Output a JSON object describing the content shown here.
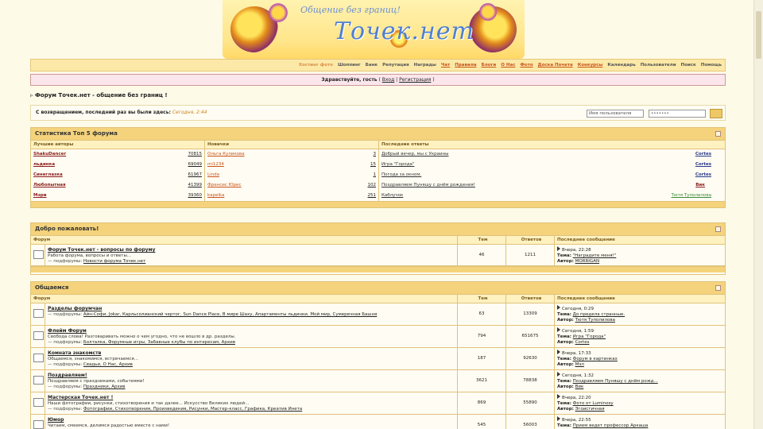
{
  "header": {
    "slogan": "Общение без границ!",
    "logo": "Точек.нет"
  },
  "menu": {
    "items": [
      "Хостинг фото",
      "Шоппинг",
      "Банк",
      "Репутация",
      "Награды",
      "Чат",
      "Правила",
      "Блоги",
      "О Нас",
      "Фото",
      "Доска Почета",
      "Конкурсы",
      "Календарь",
      "Пользователи",
      "Поиск",
      "Помощь"
    ]
  },
  "welcome": {
    "prefix": "Здравствуйте, гость",
    "open": " ( ",
    "login": "Вход",
    "sep": " | ",
    "register": "Регистрация",
    "close": " )"
  },
  "forum_title": "Форум Точек.нет - общение без границ !",
  "login": {
    "text": "С возвращением, последний раз вы были здесь:",
    "date": "Сегодня, 2:44",
    "username_placeholder": "Имя пользователя",
    "password_value": "•••••••"
  },
  "stats": {
    "title": "Статистика Топ 5 форума",
    "col_authors": "Лучшие авторы",
    "col_new": "Новички",
    "col_replies": "Последние ответы",
    "authors": [
      {
        "name": "ShakuDancer",
        "count": "70815"
      },
      {
        "name": "льдинка",
        "count": "69049"
      },
      {
        "name": "Синеглазка",
        "count": "61967"
      },
      {
        "name": "Любопытная",
        "count": "41399"
      },
      {
        "name": "Мэри",
        "count": "39360"
      }
    ],
    "newbies": [
      {
        "name": "Ольга Куликова",
        "count": "3"
      },
      {
        "name": "mi1234",
        "count": "15"
      },
      {
        "name": "Linda",
        "count": "1"
      },
      {
        "name": "Френсис Юрис",
        "count": "102"
      },
      {
        "name": "kapelka",
        "count": "251"
      }
    ],
    "replies": [
      {
        "topic": "Добрый вечер, мы с Украины",
        "author": "Cortes"
      },
      {
        "topic": "Игра \"Города\"",
        "author": "Cortes"
      },
      {
        "topic": "Погода за окном.",
        "author": "Cortes"
      },
      {
        "topic": "Поздравляем Пуняшу с днём рождения!",
        "author": "Вик"
      },
      {
        "topic": "Каблучок",
        "author": "Тютя Туполилова"
      }
    ]
  },
  "cols": {
    "forum": "Форум",
    "topics": "Тем",
    "replies": "Ответов",
    "last": "Последнее сообщение"
  },
  "welcome_section": {
    "title": "Добро пожаловать!",
    "forums": [
      {
        "title": "Форум Точек.нет - вопросы по форуму",
        "desc": "Работа форума, вопросы и ответы...",
        "sub_label": "— подфорумы:",
        "subs": "Новости форума Точек.нет",
        "topics": "46",
        "replies": "1211",
        "last_time": "Вчера, 22:28",
        "last_topic_label": "Тема:",
        "last_topic": "\"Наградите меня!\"",
        "last_author_label": "Автор:",
        "last_author": "MORRIGAN"
      }
    ]
  },
  "general": {
    "title": "Общаемся",
    "forums": [
      {
        "title": "Разделы форумчан",
        "desc": "",
        "sub_label": "— подфорумы:",
        "subs": "Айн-Софи, Jokar, Карльсолианский чертог, Sun Dance Place, В мире Шаху, Апартаменты льдинки, Мой мир, Сумеречная Башня",
        "topics": "63",
        "replies": "13309",
        "last_time": "Сегодня, 0:29",
        "last_topic_label": "Тема:",
        "last_topic": "До предела странные.",
        "last_author_label": "Автор:",
        "last_author": "Тютя Туполилова"
      },
      {
        "title": "Флейм Форум",
        "desc": "Свобода слова! Разговаривать можно о чем угодно, что не вошло в др. разделы.",
        "sub_label": "— подфорумы:",
        "subs": "Болталка, Форумные игры, Забавные клубы по интересам, Архив",
        "topics": "794",
        "replies": "651675",
        "last_time": "Сегодня, 1:59",
        "last_topic_label": "Тема:",
        "last_topic": "Игра \"Города\"",
        "last_author_label": "Автор:",
        "last_author": "Cortes"
      },
      {
        "title": "Комната знакомств",
        "desc": "Общаемся, знакомимся, встречаемся...",
        "sub_label": "— подфорумы:",
        "subs": "Свадьи, О Нас, Архив",
        "topics": "187",
        "replies": "92630",
        "last_time": "Вчера, 17:33",
        "last_topic_label": "Тема:",
        "last_topic": "Форум в картинках",
        "last_author_label": "Автор:",
        "last_author": "Мэл"
      },
      {
        "title": "Поздравляем!",
        "desc": "Поздравляем с праздниками, событиями!",
        "sub_label": "— подфорумы:",
        "subs": "Праздники, Архив",
        "topics": "3621",
        "replies": "78838",
        "last_time": "Сегодня, 1:32",
        "last_topic_label": "Тема:",
        "last_topic": "Поздравляем Пуняшу с днём рожд...",
        "last_author_label": "Автор:",
        "last_author": "Вик"
      },
      {
        "title": "Мастерская Точек.нет !",
        "desc": "Наши фотографии, рисунки, стихотворения и так далее... Искусство Великих людей...",
        "sub_label": "— подфорумы:",
        "subs": "Фотографии, Стихотворения, Произведения, Рисунки, Мастер-класс, Графика, Креатив Инета",
        "topics": "869",
        "replies": "55890",
        "last_time": "Вчера, 22:20",
        "last_topic_label": "Тема:",
        "last_topic": "Фото от Luminosy",
        "last_author_label": "Автор:",
        "last_author": "Эгоистичная"
      },
      {
        "title": "Юмор",
        "desc": "Читаем, смеемся, делимся радостью вместе с нами!",
        "sub_label": "",
        "subs": "",
        "topics": "545",
        "replies": "56003",
        "last_time": "Вчера, 22:55",
        "last_topic_label": "Тема:",
        "last_topic": "Прием ведет профессор Аркаша",
        "last_author_label": "",
        "last_author": ""
      }
    ]
  }
}
